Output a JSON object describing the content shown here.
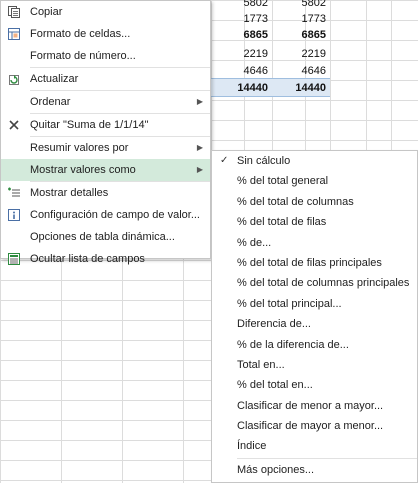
{
  "pivot": {
    "col1": [
      "5802",
      "1773",
      "6865",
      "2219",
      "4646",
      "14440"
    ],
    "col2": [
      "5802",
      "1773",
      "6865",
      "2219",
      "4646",
      "14440"
    ]
  },
  "context_menu": {
    "items": [
      {
        "label": "Copiar",
        "icon": "copy-icon"
      },
      {
        "label": "Formato de celdas...",
        "icon": "format-cells-icon"
      },
      {
        "label": "Formato de número...",
        "icon": ""
      },
      {
        "label": "Actualizar",
        "icon": "refresh-icon"
      },
      {
        "label": "Ordenar",
        "icon": "",
        "submenu": true
      },
      {
        "label": "Quitar \"Suma de 1/1/14\"",
        "icon": "remove-x-icon"
      },
      {
        "label": "Resumir valores por",
        "icon": "",
        "submenu": true
      },
      {
        "label": "Mostrar valores como",
        "icon": "",
        "submenu": true,
        "highlighted": true
      },
      {
        "label": "Mostrar detalles",
        "icon": "show-details-icon"
      },
      {
        "label": "Configuración de campo de valor...",
        "icon": "field-settings-icon"
      },
      {
        "label": "Opciones de tabla dinámica...",
        "icon": ""
      },
      {
        "label": "Ocultar lista de campos",
        "icon": "field-list-icon"
      }
    ]
  },
  "submenu": {
    "items": [
      {
        "label": "Sin cálculo",
        "checked": true
      },
      {
        "label": "% del total general"
      },
      {
        "label": "% del total de columnas"
      },
      {
        "label": "% del total de filas"
      },
      {
        "label": "% de..."
      },
      {
        "label": "% del total de filas principales"
      },
      {
        "label": "% del total de columnas principales"
      },
      {
        "label": "% del total principal..."
      },
      {
        "label": "Diferencia de..."
      },
      {
        "label": "% de la diferencia de..."
      },
      {
        "label": "Total en..."
      },
      {
        "label": "% del total en..."
      },
      {
        "label": "Clasificar de menor a mayor..."
      },
      {
        "label": "Clasificar de mayor a menor..."
      },
      {
        "label": "Índice"
      },
      {
        "label": "Más opciones..."
      }
    ]
  },
  "colors": {
    "highlight": "#d3eadb",
    "total_row": "#dde8f4"
  }
}
